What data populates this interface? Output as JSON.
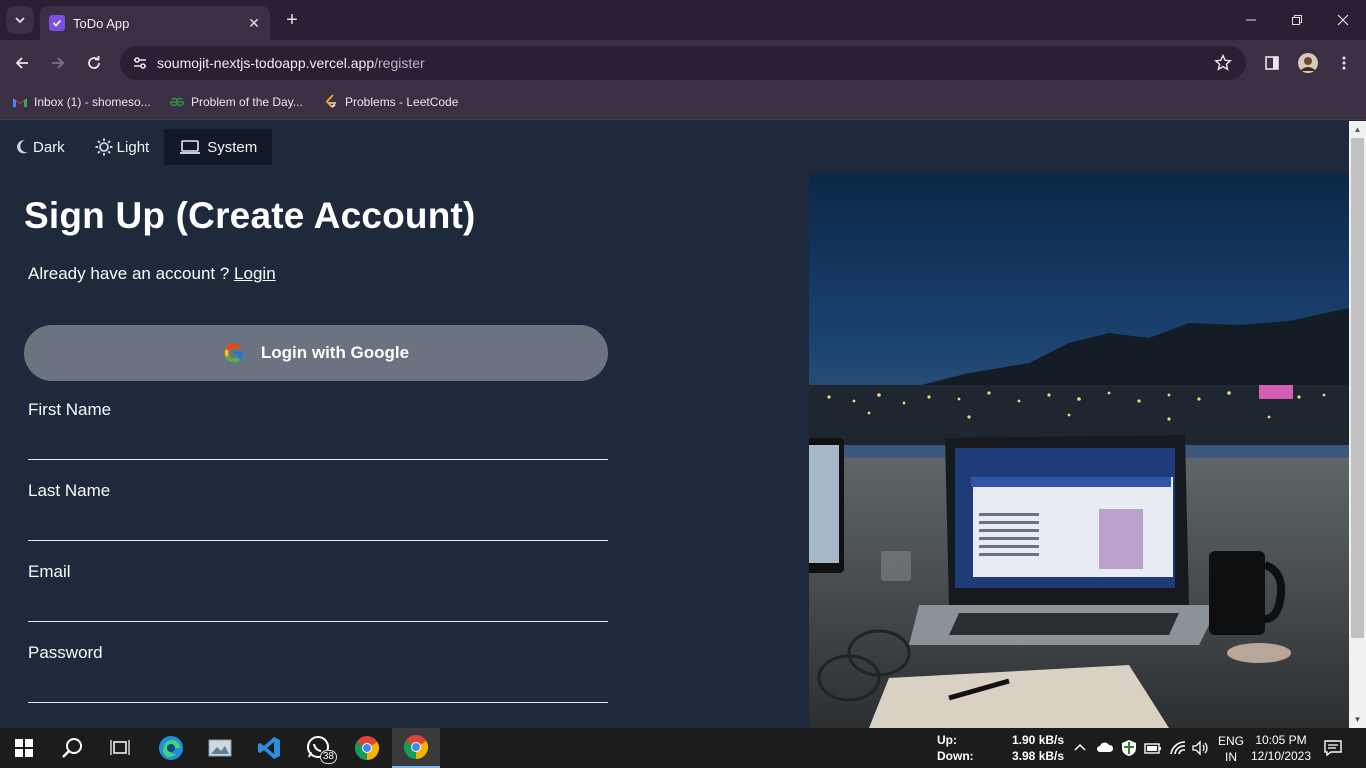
{
  "browser": {
    "tab_title": "ToDo App",
    "url_host": "soumojit-nextjs-todoapp.vercel.app",
    "url_path": "/register",
    "bookmarks": [
      {
        "label": "Inbox (1) - shomeso..."
      },
      {
        "label": "Problem of the Day..."
      },
      {
        "label": "Problems - LeetCode"
      }
    ]
  },
  "theme_switch": {
    "dark": "Dark",
    "light": "Light",
    "system": "System",
    "selected": "System"
  },
  "form": {
    "title": "Sign Up (Create Account)",
    "already_text": "Already have an account ?",
    "login_link": "Login",
    "google_button": "Login with Google",
    "fields": {
      "first_name": "First Name",
      "last_name": "Last Name",
      "email": "Email",
      "password": "Password"
    }
  },
  "taskbar": {
    "net_up_label": "Up:",
    "net_down_label": "Down:",
    "net_up_value": "1.90 kB/s",
    "net_down_value": "3.98 kB/s",
    "whatsapp_badge": "38",
    "lang_top": "ENG",
    "lang_bottom": "IN",
    "time": "10:05 PM",
    "date": "12/10/2023"
  },
  "colors": {
    "page_bg": "#1e293b",
    "google_button_bg": "#6b7280",
    "browser_frame": "#3b2f44"
  }
}
